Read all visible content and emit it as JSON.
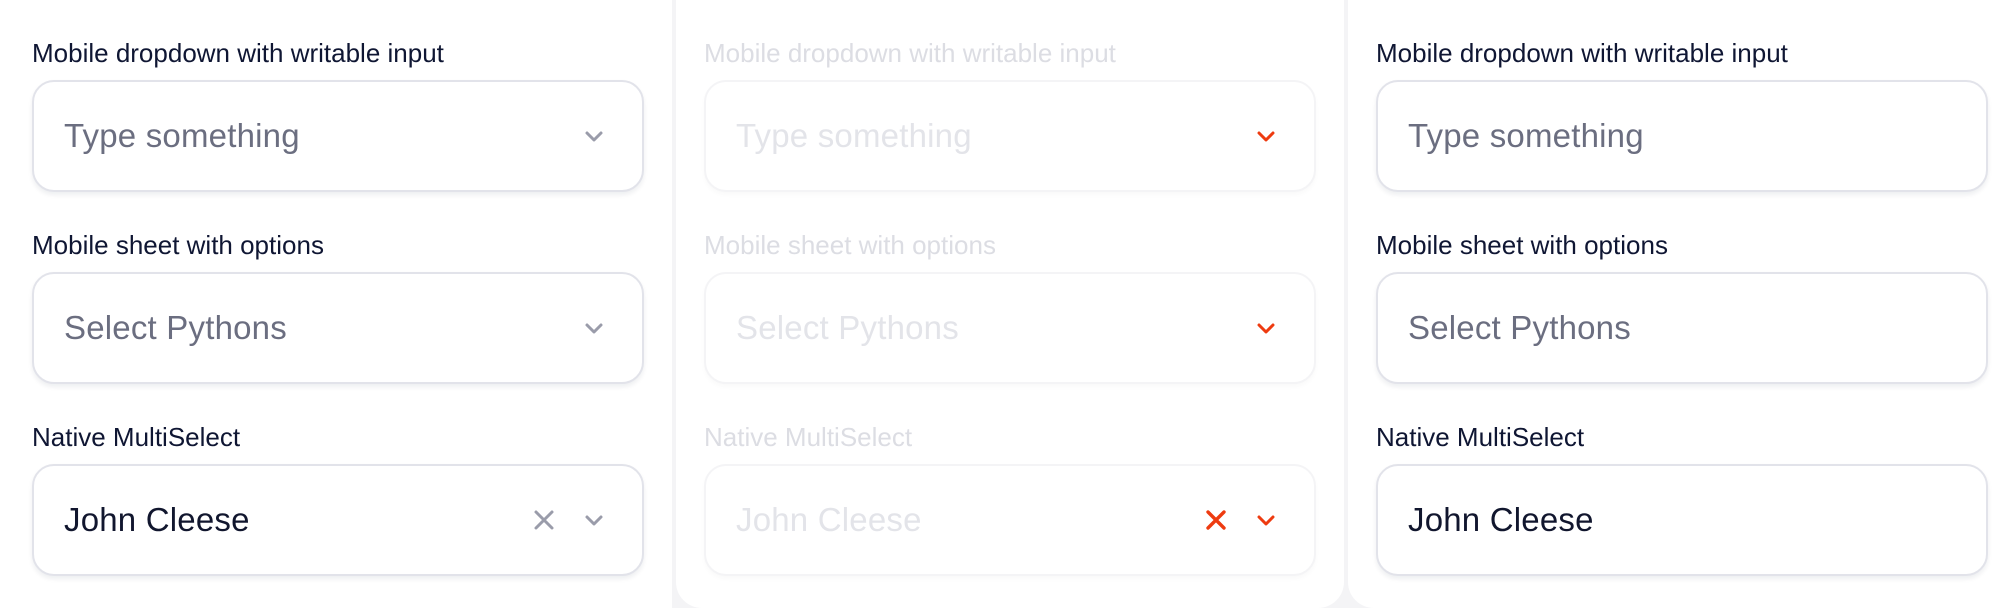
{
  "columns": [
    {
      "state": "default",
      "fields": [
        {
          "label": "Mobile dropdown with writable input",
          "placeholder": "Type something",
          "value": "",
          "has_chevron": true,
          "has_clear": false
        },
        {
          "label": "Mobile sheet with options",
          "placeholder": "Select Pythons",
          "value": "",
          "has_chevron": true,
          "has_clear": false
        },
        {
          "label": "Native MultiSelect",
          "placeholder": "",
          "value": "John Cleese",
          "has_chevron": true,
          "has_clear": true
        }
      ]
    },
    {
      "state": "disabled",
      "fields": [
        {
          "label": "Mobile dropdown with writable input",
          "placeholder": "Type something",
          "value": "",
          "has_chevron": true,
          "has_clear": false
        },
        {
          "label": "Mobile sheet with options",
          "placeholder": "Select Pythons",
          "value": "",
          "has_chevron": true,
          "has_clear": false
        },
        {
          "label": "Native MultiSelect",
          "placeholder": "",
          "value": "John Cleese",
          "has_chevron": true,
          "has_clear": true
        }
      ]
    },
    {
      "state": "no-controls",
      "fields": [
        {
          "label": "Mobile dropdown with writable input",
          "placeholder": "Type something",
          "value": "",
          "has_chevron": false,
          "has_clear": false
        },
        {
          "label": "Mobile sheet with options",
          "placeholder": "Select Pythons",
          "value": "",
          "has_chevron": false,
          "has_clear": false
        },
        {
          "label": "Native MultiSelect",
          "placeholder": "",
          "value": "John Cleese",
          "has_chevron": false,
          "has_clear": false
        }
      ]
    }
  ],
  "icons": {
    "chevron": "chevron-down-icon",
    "clear": "close-icon"
  },
  "colors": {
    "background": "#f4f4f6",
    "panel": "#ffffff",
    "label": "#0f1633",
    "placeholder": "#6b6e80",
    "value": "#11162e",
    "icon_default": "#9a9caa",
    "icon_disabled_accent": "#ee3b10",
    "border": "#e2e3ea"
  }
}
